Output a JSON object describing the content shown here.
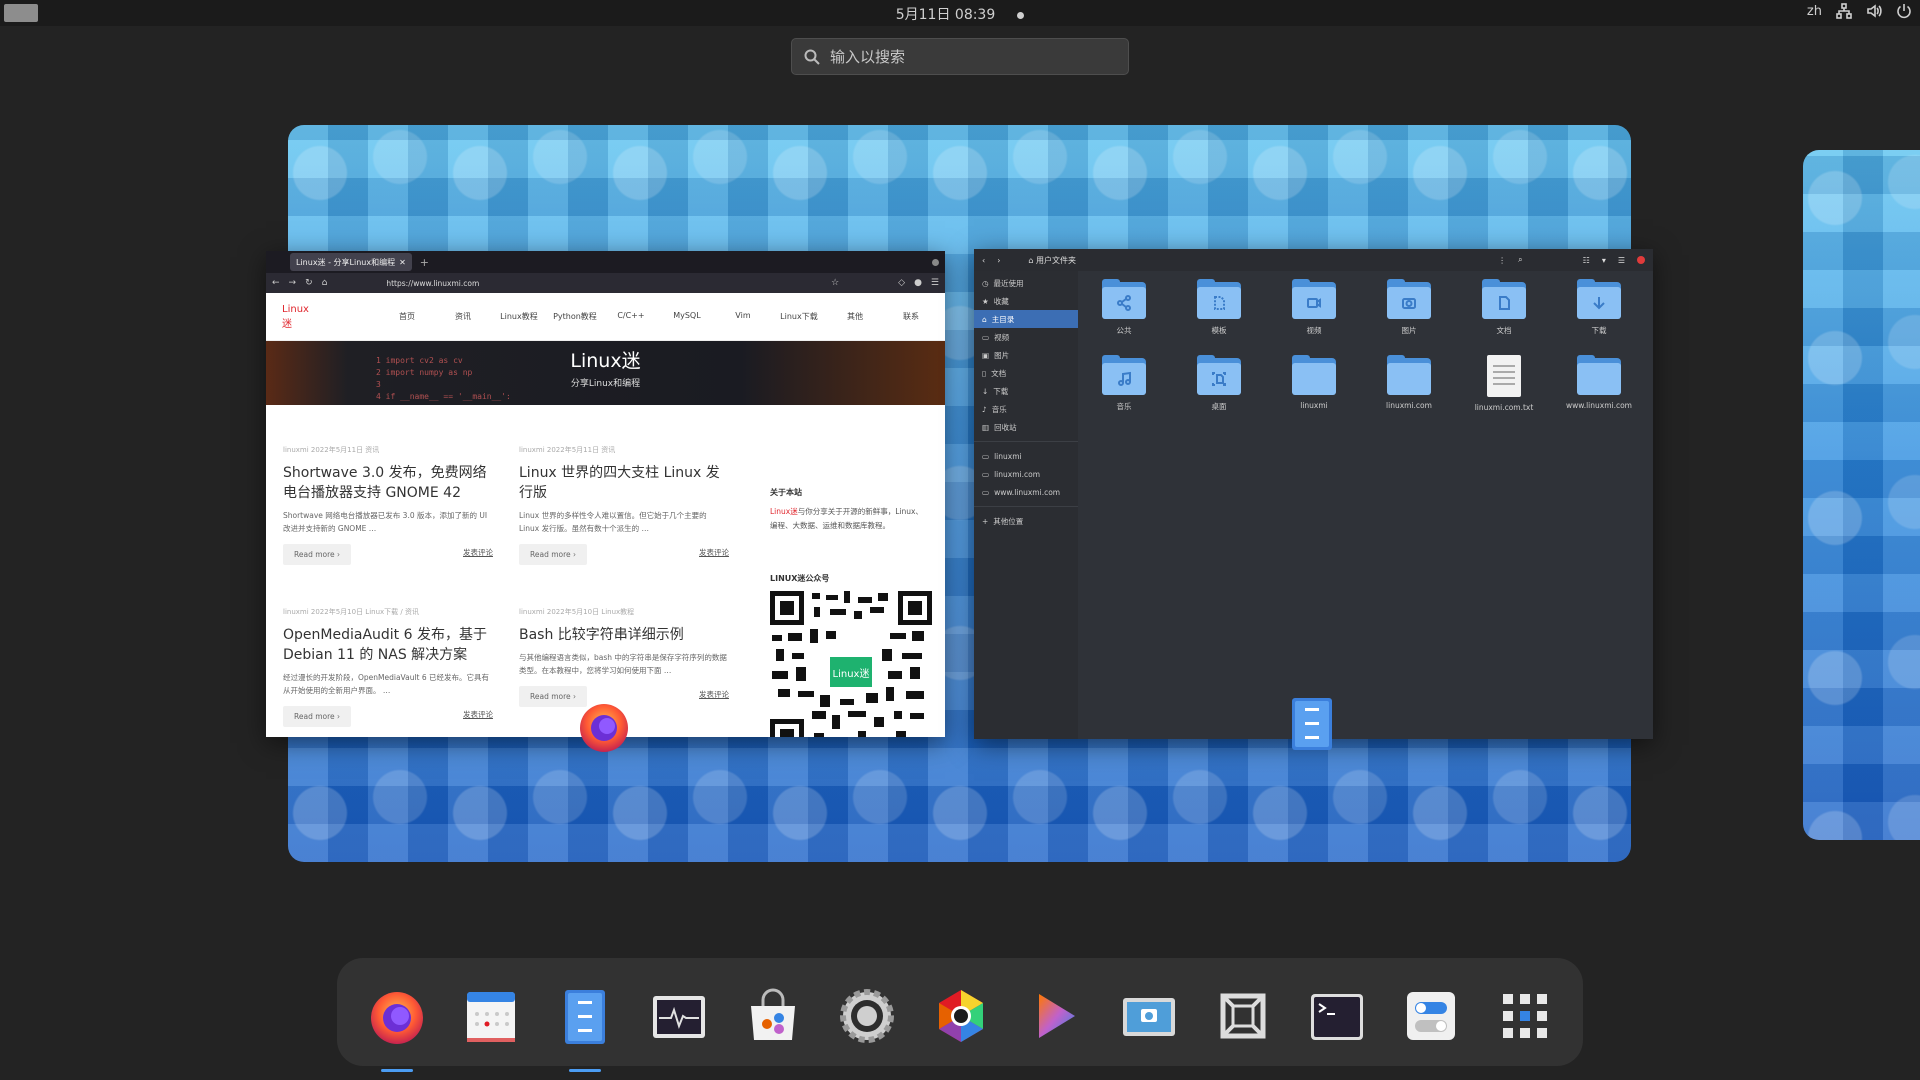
{
  "topbar": {
    "clock": "5月11日  08:39",
    "input_source": "zh"
  },
  "search": {
    "placeholder": "输入以搜索"
  },
  "browser": {
    "tab_title": "Linux迷 - 分享Linux和编程",
    "url": "https://www.linuxmi.com",
    "site": {
      "logo": "Linux迷",
      "menu": [
        "首页",
        "资讯",
        "Linux教程",
        "Python教程",
        "C/C++",
        "MySQL",
        "Vim",
        "Linux下载",
        "其他",
        "联系"
      ],
      "hero_title": "Linux迷",
      "hero_subtitle": "分享Linux和编程",
      "hero_code": [
        "1   import cv2 as cv",
        "2   import numpy as np",
        "3",
        "4   if __name__ == '__main__':"
      ],
      "posts": [
        {
          "meta": "linuxmi   2022年5月11日   资讯",
          "title": "Shortwave 3.0 发布，免费网络电台播放器支持 GNOME 42",
          "excerpt": "Shortwave 网络电台播放器已发布 3.0 版本，添加了新的 UI 改进并支持新的 GNOME …",
          "readmore": "Read more  ›",
          "comment": "发表评论"
        },
        {
          "meta": "linuxmi   2022年5月11日   资讯",
          "title": "Linux 世界的四大支柱 Linux 发行版",
          "excerpt": "Linux 世界的多样性令人难以置信。但它始于几个主要的 Linux 发行版。虽然有数十个派生的 …",
          "readmore": "Read more  ›",
          "comment": "发表评论"
        },
        {
          "meta": "linuxmi   2022年5月10日   Linux下载 / 资讯",
          "title": "OpenMediaAudit 6 发布，基于 Debian 11 的 NAS 解决方案",
          "excerpt": "经过漫长的开发阶段，OpenMediaVault 6 已经发布。它具有从开始使用的全新用户界面。 …",
          "readmore": "Read more  ›",
          "comment": "发表评论"
        },
        {
          "meta": "linuxmi   2022年5月10日   Linux教程",
          "title": "Bash 比较字符串详细示例",
          "excerpt": "与其他编程语言类似，bash 中的字符串是保存字符序列的数据类型。在本教程中，您将学习如何使用下面 …",
          "readmore": "Read more  ›",
          "comment": "发表评论"
        }
      ],
      "about_heading": "关于本站",
      "about_brand": "Linux迷",
      "about_text": "与你分享关于开源的新鲜事，Linux、编程、大数据、运维和数据库教程。",
      "qr_heading": "LINUX迷公众号",
      "qr_badge": "Linux迷"
    }
  },
  "files": {
    "title": "用户文件夹",
    "sidebar": [
      {
        "label": "最近使用",
        "active": false
      },
      {
        "label": "收藏",
        "active": false
      },
      {
        "label": "主目录",
        "active": true
      },
      {
        "label": "视频",
        "active": false
      },
      {
        "label": "图片",
        "active": false
      },
      {
        "label": "文档",
        "active": false
      },
      {
        "label": "下载",
        "active": false
      },
      {
        "label": "音乐",
        "active": false
      },
      {
        "label": "回收站",
        "active": false
      }
    ],
    "bookmarks": [
      "linuxmi",
      "linuxmi.com",
      "www.linuxmi.com"
    ],
    "other_locations": "其他位置",
    "items": [
      {
        "label": "公共",
        "icon": "share-icon"
      },
      {
        "label": "模板",
        "icon": "template-icon"
      },
      {
        "label": "视频",
        "icon": "video-icon"
      },
      {
        "label": "图片",
        "icon": "camera-icon"
      },
      {
        "label": "文档",
        "icon": "document-icon"
      },
      {
        "label": "下载",
        "icon": "download-icon"
      },
      {
        "label": "音乐",
        "icon": "music-icon"
      },
      {
        "label": "桌面",
        "icon": "desktop-icon"
      },
      {
        "label": "linuxmi",
        "icon": ""
      },
      {
        "label": "linuxmi.com",
        "icon": ""
      },
      {
        "label": "linuxmi.com.txt",
        "icon": "text-file-icon"
      },
      {
        "label": "www.linuxmi.com",
        "icon": ""
      }
    ]
  },
  "dock": {
    "apps": [
      "firefox",
      "calendar",
      "files",
      "system-monitor",
      "software",
      "settings",
      "web-browser",
      "videos",
      "screenshot",
      "boxes",
      "terminal",
      "tweaks",
      "show-apps"
    ],
    "running": [
      "firefox",
      "files"
    ],
    "accent": "#4b9cf2"
  }
}
